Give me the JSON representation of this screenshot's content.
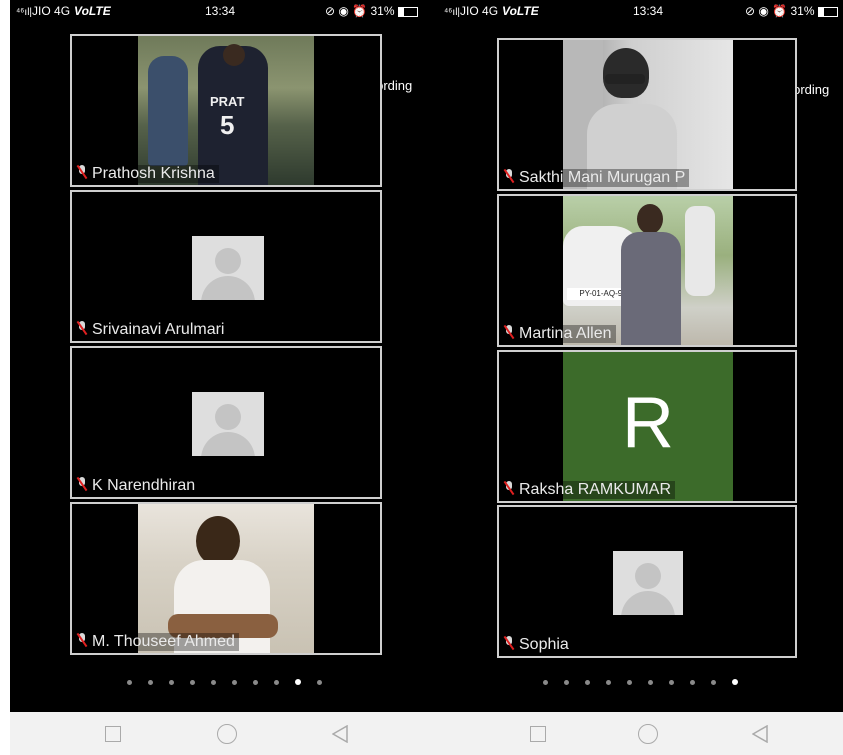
{
  "screens": [
    {
      "status": {
        "carrier": "JIO 4G",
        "volte": "VoLTE",
        "time": "13:34",
        "battery": "31%",
        "battery_level": 0.31
      },
      "recording_label": "Recording",
      "participants": [
        {
          "name": "Prathosh Krishna",
          "video": "photo",
          "jersey": "PRAT",
          "number": "5"
        },
        {
          "name": "Srivainavi Arulmari",
          "video": "avatar"
        },
        {
          "name": "K Narendhiran",
          "video": "avatar"
        },
        {
          "name": "M. Thouseef Ahmed",
          "video": "photo"
        }
      ],
      "page_dots": 10,
      "active_dot_index": 8
    },
    {
      "status": {
        "carrier": "JIO 4G",
        "volte": "VoLTE",
        "time": "13:34",
        "battery": "31%",
        "battery_level": 0.31
      },
      "recording_label": "Recording",
      "participants": [
        {
          "name": "Sakthi Mani Murugan P",
          "video": "photo"
        },
        {
          "name": "Martina Allen",
          "video": "photo",
          "plate": "PY-01-AQ-92"
        },
        {
          "name": "Raksha RAMKUMAR",
          "video": "initial",
          "initial": "R",
          "bg_color": "#3c6b2a"
        },
        {
          "name": "Sophia",
          "video": "avatar"
        }
      ],
      "page_dots": 10,
      "active_dot_index": 9
    }
  ],
  "navbar": {
    "icons": [
      "square-icon",
      "circle-icon",
      "back-triangle-icon"
    ]
  }
}
